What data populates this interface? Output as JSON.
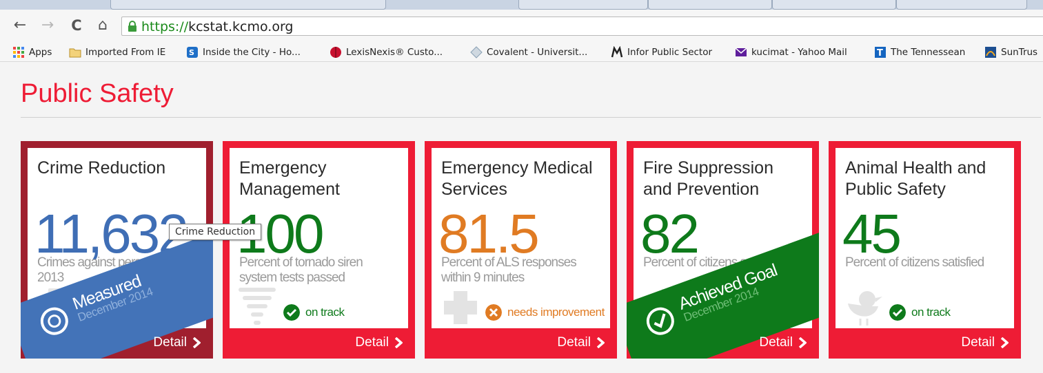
{
  "browser": {
    "url_scheme": "https://",
    "url_host": "kcstat.kcmo.org",
    "bookmarks": [
      {
        "label": "Apps",
        "icon": "apps-grid-icon"
      },
      {
        "label": "Imported From IE",
        "icon": "folder-icon"
      },
      {
        "label": "Inside the City - Ho...",
        "icon": "sharepoint-icon"
      },
      {
        "label": "LexisNexis® Custo...",
        "icon": "lexisnexis-icon"
      },
      {
        "label": "Covalent - Universit...",
        "icon": "covalent-icon"
      },
      {
        "label": "Infor Public Sector",
        "icon": "infor-icon"
      },
      {
        "label": "kucimat - Yahoo Mail",
        "icon": "yahoo-mail-icon"
      },
      {
        "label": "The Tennessean",
        "icon": "tennessean-icon"
      },
      {
        "label": "SunTrus",
        "icon": "suntrust-icon"
      }
    ]
  },
  "page": {
    "title": "Public Safety",
    "tooltip": "Crime Reduction"
  },
  "cards": [
    {
      "title": "Crime Reduction",
      "value": "11,632",
      "value_color": "#3f6eb5",
      "description": "Crimes against persons in 2013",
      "icon": "police-car-icon",
      "ribbon": {
        "main": "Measured",
        "sub": "December 2014",
        "color": "#4373b8"
      },
      "detail": "Detail"
    },
    {
      "title": "Emergency Management",
      "value": "100",
      "value_color": "#0e7a1b",
      "description": "Percent of tornado siren system tests passed",
      "icon": "tornado-icon",
      "status": {
        "label": "on track",
        "color": "#0e7a1b",
        "icon": "check-circle-icon"
      },
      "detail": "Detail"
    },
    {
      "title": "Emergency Medical Services",
      "value": "81.5",
      "value_color": "#e07b23",
      "description": "Percent of ALS responses within 9 minutes",
      "icon": "medical-cross-icon",
      "status": {
        "label": "needs improvement",
        "color": "#e07b23",
        "icon": "x-circle-icon"
      },
      "detail": "Detail"
    },
    {
      "title": "Fire Suppression and Prevention",
      "value": "82",
      "value_color": "#0e7a1b",
      "description": "Percent of citizens satisfied",
      "icon": "flame-icon",
      "ribbon": {
        "main": "Achieved Goal",
        "sub": "December 2014",
        "color": "#0e7a1b"
      },
      "detail": "Detail"
    },
    {
      "title": "Animal Health and Public Safety",
      "value": "45",
      "value_color": "#0e7a1b",
      "description": "Percent of citizens satisfied",
      "icon": "bird-icon",
      "status": {
        "label": "on track",
        "color": "#0e7a1b",
        "icon": "check-circle-icon"
      },
      "detail": "Detail"
    }
  ]
}
